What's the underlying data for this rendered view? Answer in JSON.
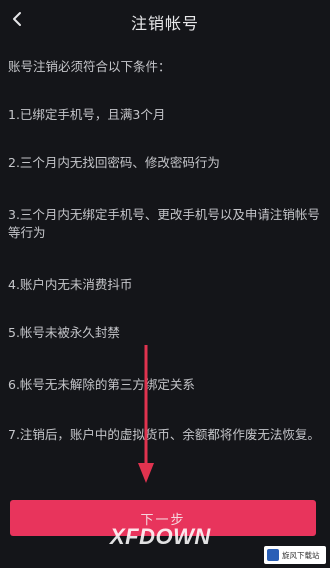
{
  "header": {
    "title": "注销帐号",
    "back_icon": "chevron-left-icon"
  },
  "content": {
    "intro": "账号注销必须符合以下条件：",
    "conditions": [
      "1.已绑定手机号，且满3个月",
      "2.三个月内无找回密码、修改密码行为",
      "3.三个月内无绑定手机号、更改手机号以及申请注销帐号等行为",
      "4.账户内无未消费抖币",
      "5.帐号未被永久封禁",
      "6.帐号无未解除的第三方绑定关系",
      "7.注销后，账户中的虚拟货币、余额都将作废无法恢复。"
    ]
  },
  "footer": {
    "next_label": "下一步"
  },
  "overlay": {
    "watermark": "XFDOWN",
    "badge_text": "旋风下载站"
  },
  "colors": {
    "background": "#141519",
    "accent": "#e8345c",
    "arrow": "#e0334f"
  }
}
